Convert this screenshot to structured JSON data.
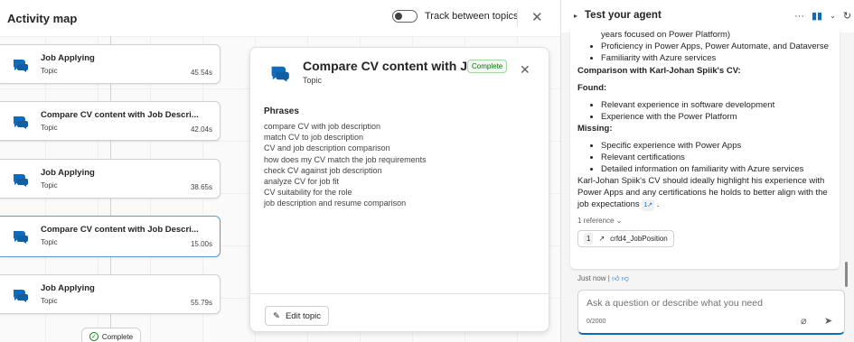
{
  "left": {
    "title": "Activity map",
    "toggle_label": "Track between topics",
    "close": "✕",
    "nodes": [
      {
        "title": "Job Applying",
        "sub": "Topic",
        "dur": "45.54s"
      },
      {
        "title": "Compare CV content with Job Descri...",
        "sub": "Topic",
        "dur": "42.04s"
      },
      {
        "title": "Job Applying",
        "sub": "Topic",
        "dur": "38.65s"
      },
      {
        "title": "Compare CV content with Job Descri...",
        "sub": "Topic",
        "dur": "15.00s"
      },
      {
        "title": "Job Applying",
        "sub": "Topic",
        "dur": "55.79s"
      }
    ],
    "complete_label": "Complete"
  },
  "detail": {
    "title": "Compare CV content with J...",
    "badge": "Complete",
    "sub": "Topic",
    "close": "✕",
    "phrases_heading": "Phrases",
    "phrases": [
      "compare CV with job description",
      "match CV to job description",
      "CV and job description comparison",
      "how does my CV match the job requirements",
      "check CV against job description",
      "analyze CV for job fit",
      "CV suitability for the role",
      "job description and resume comparison"
    ],
    "edit_label": "Edit topic"
  },
  "right": {
    "title": "Test your agent",
    "more": "···",
    "msg": {
      "top_items": [
        "years focused on Power Platform)",
        "Proficiency in Power Apps, Power Automate, and Dataverse",
        "Familiarity with Azure services"
      ],
      "comparison_heading": "Comparison with Karl-Johan Spiik's CV:",
      "found_heading": "Found:",
      "found_items": [
        "Relevant experience in software development",
        "Experience with the Power Platform"
      ],
      "missing_heading": "Missing:",
      "missing_items": [
        "Specific experience with Power Apps",
        "Relevant certifications",
        "Detailed information on familiarity with Azure services"
      ],
      "conclusion": "Karl-Johan Spiik's CV should ideally highlight his experience with Power Apps and any certifications he holds to better align with the job expectations",
      "cite": "1",
      "ref_count": "1 reference",
      "ref_num": "1",
      "ref_name": "crfd4_JobPosition"
    },
    "time": "Just now",
    "input_placeholder": "Ask a question or describe what you need",
    "char_count": "0/2000"
  },
  "colors": {
    "accent": "#0f6cbd",
    "complete_green": "#107c10"
  }
}
